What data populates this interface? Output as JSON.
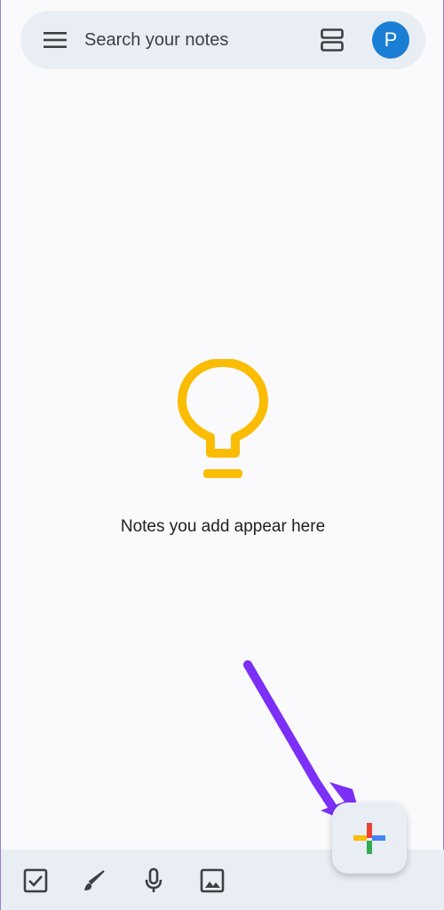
{
  "search": {
    "placeholder": "Search your notes"
  },
  "account": {
    "initial": "P",
    "color": "#1a7fd4"
  },
  "empty_state": {
    "message": "Notes you add appear here",
    "icon": "lightbulb-icon",
    "icon_color": "#fbbc04"
  },
  "bottom_bar": {
    "items": [
      {
        "icon": "checkbox-icon",
        "action": "new-list"
      },
      {
        "icon": "brush-icon",
        "action": "new-drawing"
      },
      {
        "icon": "mic-icon",
        "action": "new-audio"
      },
      {
        "icon": "image-icon",
        "action": "new-image"
      }
    ]
  },
  "fab": {
    "icon": "plus-icon",
    "colors": [
      "#ea4335",
      "#4285f4",
      "#fbbc04",
      "#34a853"
    ]
  },
  "annotation": {
    "color": "#7b2ff7"
  }
}
